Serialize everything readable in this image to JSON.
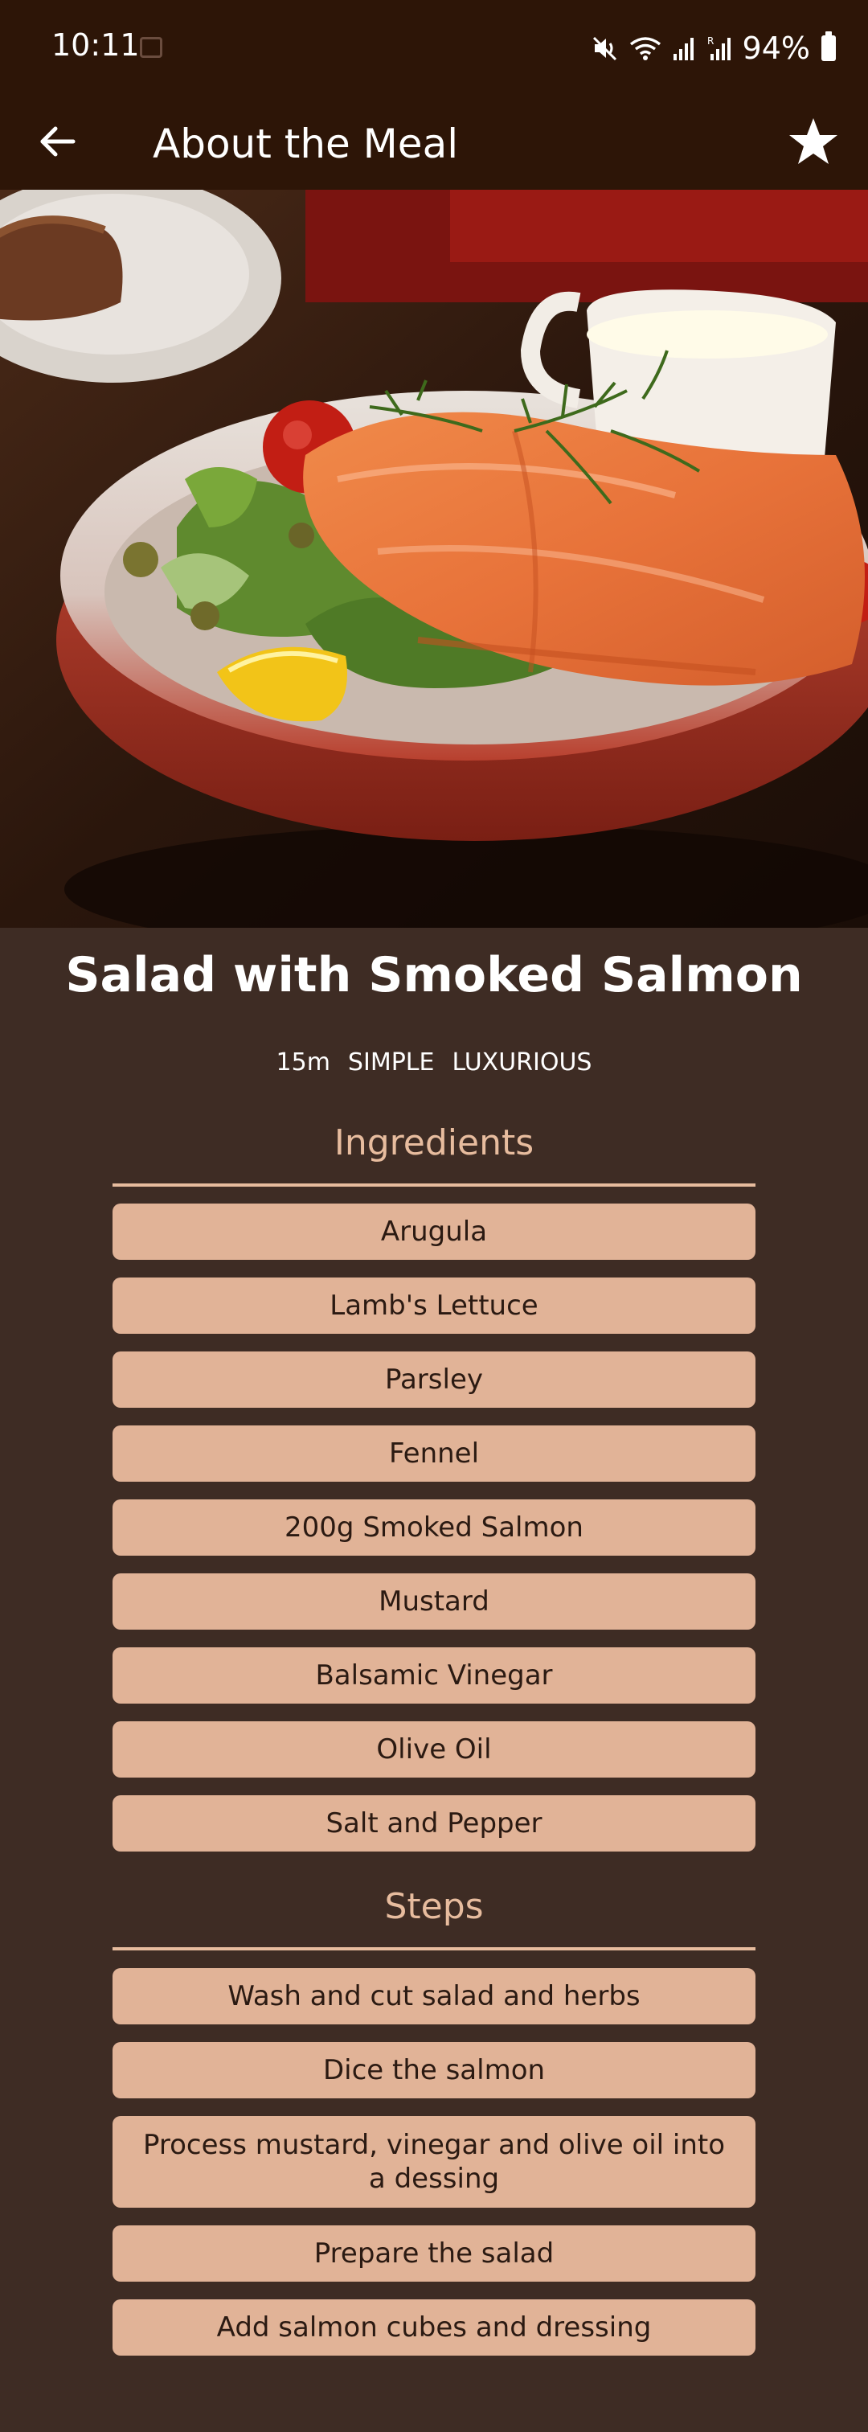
{
  "status_bar": {
    "time": "10:11",
    "battery": "94%"
  },
  "app_bar": {
    "title": "About the Meal",
    "back_icon": "arrow-left-icon",
    "favorite_icon": "star-icon"
  },
  "meal": {
    "title": "Salad with Smoked Salmon",
    "duration": "15m",
    "complexity": "SIMPLE",
    "affordability": "LUXURIOUS"
  },
  "ingredients": {
    "heading": "Ingredients",
    "items": [
      "Arugula",
      "Lamb's Lettuce",
      "Parsley",
      "Fennel",
      "200g Smoked Salmon",
      "Mustard",
      "Balsamic Vinegar",
      "Olive Oil",
      "Salt and Pepper"
    ]
  },
  "steps": {
    "heading": "Steps",
    "items": [
      "Wash and cut salad and herbs",
      "Dice the salmon",
      "Process mustard, vinegar and olive oil into a dessing",
      "Prepare the salad",
      "Add salmon cubes and dressing"
    ]
  },
  "colors": {
    "app_bar": "#2d1507",
    "background": "#3e2c24",
    "accent": "#e7bc9e",
    "chip": "#e1b397",
    "chip_text": "#2b1a12"
  }
}
